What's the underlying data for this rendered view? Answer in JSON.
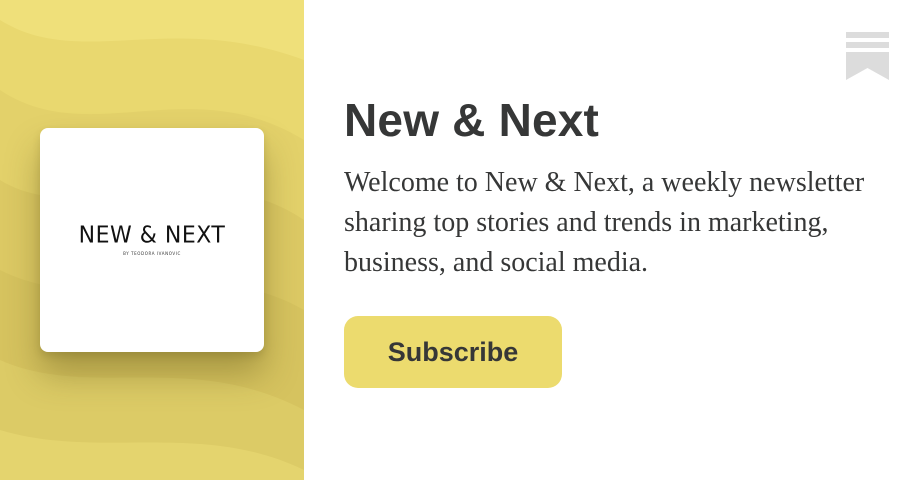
{
  "publication": {
    "title": "New & Next",
    "description": "Welcome to New & Next, a weekly newsletter sharing top stories and trends in marketing, business, and social media.",
    "logo_wordmark": "NEW & NEXT",
    "logo_subtitle": "BY TEODORA IVANOVIC"
  },
  "subscribe": {
    "label": "Subscribe"
  },
  "icons": {
    "bookmark": "bookmark-icon"
  },
  "colors": {
    "accent": "#ecdb6e",
    "panel": "#e6d46a",
    "text": "#363737",
    "bookmark": "#dcdcdc"
  }
}
